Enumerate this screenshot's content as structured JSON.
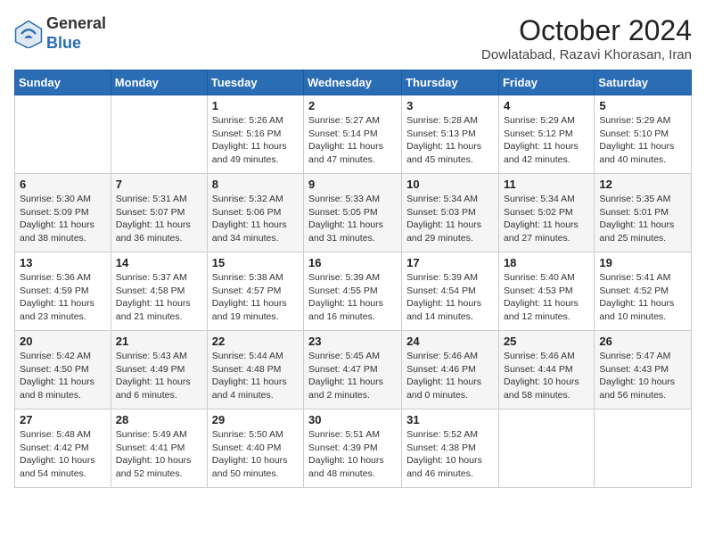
{
  "header": {
    "logo": {
      "general": "General",
      "blue": "Blue"
    },
    "title": "October 2024",
    "location": "Dowlatabad, Razavi Khorasan, Iran"
  },
  "days_of_week": [
    "Sunday",
    "Monday",
    "Tuesday",
    "Wednesday",
    "Thursday",
    "Friday",
    "Saturday"
  ],
  "weeks": [
    [
      {
        "day": "",
        "info": ""
      },
      {
        "day": "",
        "info": ""
      },
      {
        "day": "1",
        "info": "Sunrise: 5:26 AM\nSunset: 5:16 PM\nDaylight: 11 hours and 49 minutes."
      },
      {
        "day": "2",
        "info": "Sunrise: 5:27 AM\nSunset: 5:14 PM\nDaylight: 11 hours and 47 minutes."
      },
      {
        "day": "3",
        "info": "Sunrise: 5:28 AM\nSunset: 5:13 PM\nDaylight: 11 hours and 45 minutes."
      },
      {
        "day": "4",
        "info": "Sunrise: 5:29 AM\nSunset: 5:12 PM\nDaylight: 11 hours and 42 minutes."
      },
      {
        "day": "5",
        "info": "Sunrise: 5:29 AM\nSunset: 5:10 PM\nDaylight: 11 hours and 40 minutes."
      }
    ],
    [
      {
        "day": "6",
        "info": "Sunrise: 5:30 AM\nSunset: 5:09 PM\nDaylight: 11 hours and 38 minutes."
      },
      {
        "day": "7",
        "info": "Sunrise: 5:31 AM\nSunset: 5:07 PM\nDaylight: 11 hours and 36 minutes."
      },
      {
        "day": "8",
        "info": "Sunrise: 5:32 AM\nSunset: 5:06 PM\nDaylight: 11 hours and 34 minutes."
      },
      {
        "day": "9",
        "info": "Sunrise: 5:33 AM\nSunset: 5:05 PM\nDaylight: 11 hours and 31 minutes."
      },
      {
        "day": "10",
        "info": "Sunrise: 5:34 AM\nSunset: 5:03 PM\nDaylight: 11 hours and 29 minutes."
      },
      {
        "day": "11",
        "info": "Sunrise: 5:34 AM\nSunset: 5:02 PM\nDaylight: 11 hours and 27 minutes."
      },
      {
        "day": "12",
        "info": "Sunrise: 5:35 AM\nSunset: 5:01 PM\nDaylight: 11 hours and 25 minutes."
      }
    ],
    [
      {
        "day": "13",
        "info": "Sunrise: 5:36 AM\nSunset: 4:59 PM\nDaylight: 11 hours and 23 minutes."
      },
      {
        "day": "14",
        "info": "Sunrise: 5:37 AM\nSunset: 4:58 PM\nDaylight: 11 hours and 21 minutes."
      },
      {
        "day": "15",
        "info": "Sunrise: 5:38 AM\nSunset: 4:57 PM\nDaylight: 11 hours and 19 minutes."
      },
      {
        "day": "16",
        "info": "Sunrise: 5:39 AM\nSunset: 4:55 PM\nDaylight: 11 hours and 16 minutes."
      },
      {
        "day": "17",
        "info": "Sunrise: 5:39 AM\nSunset: 4:54 PM\nDaylight: 11 hours and 14 minutes."
      },
      {
        "day": "18",
        "info": "Sunrise: 5:40 AM\nSunset: 4:53 PM\nDaylight: 11 hours and 12 minutes."
      },
      {
        "day": "19",
        "info": "Sunrise: 5:41 AM\nSunset: 4:52 PM\nDaylight: 11 hours and 10 minutes."
      }
    ],
    [
      {
        "day": "20",
        "info": "Sunrise: 5:42 AM\nSunset: 4:50 PM\nDaylight: 11 hours and 8 minutes."
      },
      {
        "day": "21",
        "info": "Sunrise: 5:43 AM\nSunset: 4:49 PM\nDaylight: 11 hours and 6 minutes."
      },
      {
        "day": "22",
        "info": "Sunrise: 5:44 AM\nSunset: 4:48 PM\nDaylight: 11 hours and 4 minutes."
      },
      {
        "day": "23",
        "info": "Sunrise: 5:45 AM\nSunset: 4:47 PM\nDaylight: 11 hours and 2 minutes."
      },
      {
        "day": "24",
        "info": "Sunrise: 5:46 AM\nSunset: 4:46 PM\nDaylight: 11 hours and 0 minutes."
      },
      {
        "day": "25",
        "info": "Sunrise: 5:46 AM\nSunset: 4:44 PM\nDaylight: 10 hours and 58 minutes."
      },
      {
        "day": "26",
        "info": "Sunrise: 5:47 AM\nSunset: 4:43 PM\nDaylight: 10 hours and 56 minutes."
      }
    ],
    [
      {
        "day": "27",
        "info": "Sunrise: 5:48 AM\nSunset: 4:42 PM\nDaylight: 10 hours and 54 minutes."
      },
      {
        "day": "28",
        "info": "Sunrise: 5:49 AM\nSunset: 4:41 PM\nDaylight: 10 hours and 52 minutes."
      },
      {
        "day": "29",
        "info": "Sunrise: 5:50 AM\nSunset: 4:40 PM\nDaylight: 10 hours and 50 minutes."
      },
      {
        "day": "30",
        "info": "Sunrise: 5:51 AM\nSunset: 4:39 PM\nDaylight: 10 hours and 48 minutes."
      },
      {
        "day": "31",
        "info": "Sunrise: 5:52 AM\nSunset: 4:38 PM\nDaylight: 10 hours and 46 minutes."
      },
      {
        "day": "",
        "info": ""
      },
      {
        "day": "",
        "info": ""
      }
    ]
  ]
}
